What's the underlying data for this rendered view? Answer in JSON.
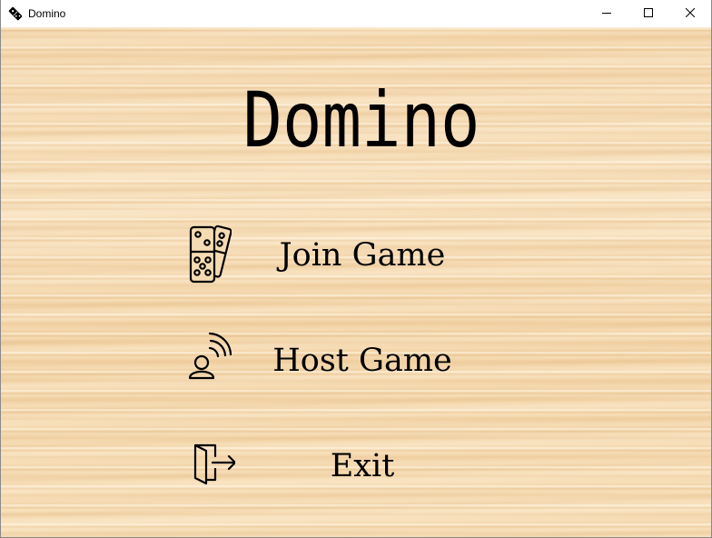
{
  "window": {
    "title": "Domino",
    "app_icon": "domino-icon",
    "controls": [
      "minimize-icon",
      "maximize-icon",
      "close-icon"
    ]
  },
  "main": {
    "heading": "Domino",
    "menu": [
      {
        "label": "Join Game",
        "icon": "domino-tiles-icon"
      },
      {
        "label": "Host Game",
        "icon": "broadcast-user-icon"
      },
      {
        "label": "Exit",
        "icon": "exit-door-icon"
      }
    ]
  },
  "colors": {
    "wood": "#f5dbb3",
    "text": "#000000"
  }
}
